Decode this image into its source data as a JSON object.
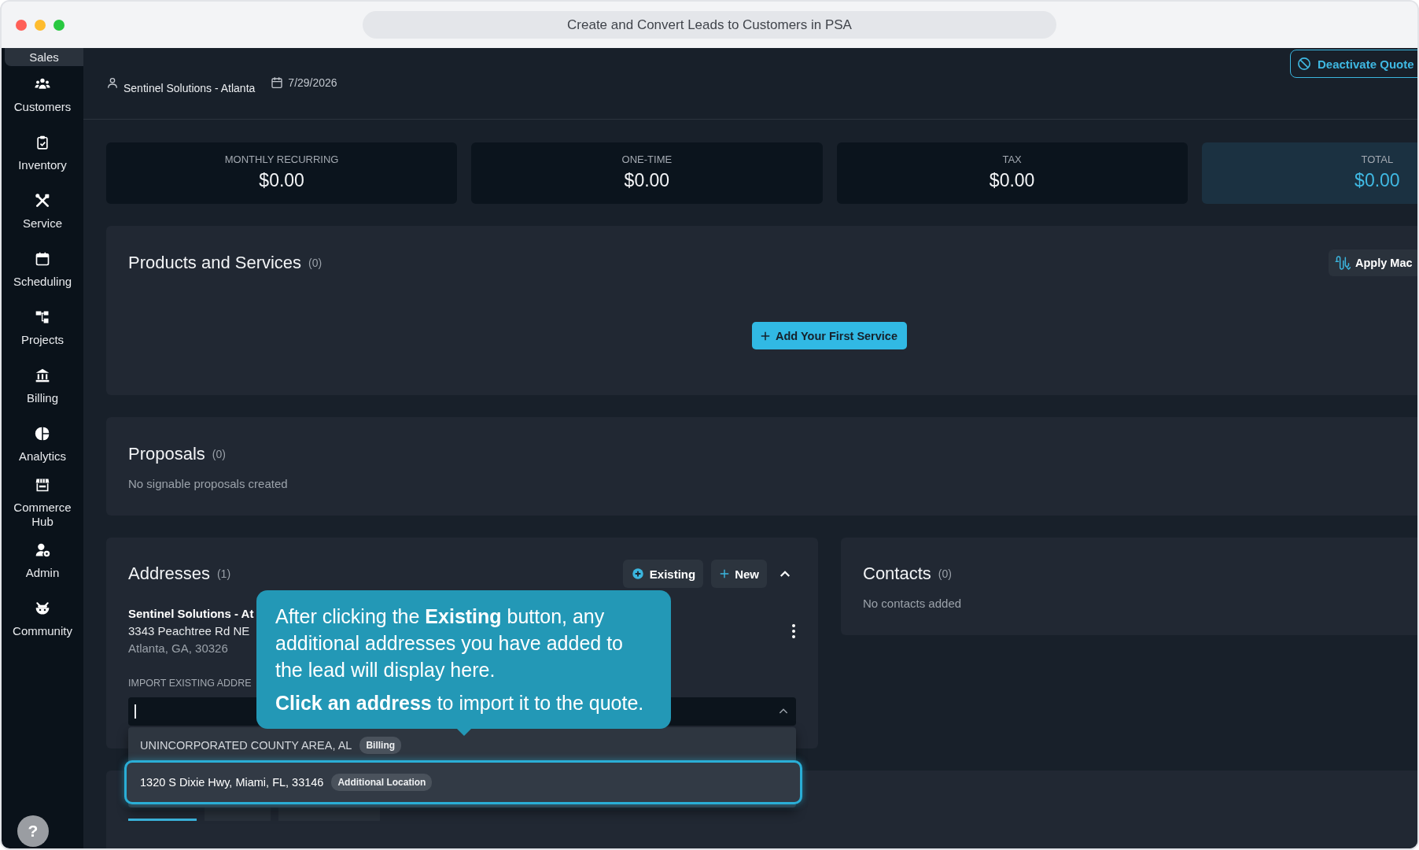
{
  "window": {
    "title": "Create and Convert Leads to Customers in PSA"
  },
  "sidebar": {
    "items": [
      {
        "label": "Sales",
        "selected": true
      },
      {
        "label": "Customers",
        "selected": false
      },
      {
        "label": "Inventory",
        "selected": false
      },
      {
        "label": "Service",
        "selected": false
      },
      {
        "label": "Scheduling",
        "selected": false
      },
      {
        "label": "Projects",
        "selected": false
      },
      {
        "label": "Billing",
        "selected": false
      },
      {
        "label": "Analytics",
        "selected": false
      },
      {
        "label": "Commerce Hub",
        "selected": false
      },
      {
        "label": "Admin",
        "selected": false
      },
      {
        "label": "Community",
        "selected": false
      }
    ],
    "help": "?"
  },
  "header": {
    "customer": "Sentinel Solutions - Atlanta",
    "date": "7/29/2026",
    "deactivate_button": "Deactivate Quote"
  },
  "summary": [
    {
      "label": "MONTHLY RECURRING",
      "value": "$0.00",
      "highlighted": false
    },
    {
      "label": "ONE-TIME",
      "value": "$0.00",
      "highlighted": false
    },
    {
      "label": "TAX",
      "value": "$0.00",
      "highlighted": false
    },
    {
      "label": "TOTAL",
      "value": "$0.00",
      "highlighted": true
    }
  ],
  "products": {
    "title": "Products and Services",
    "count": "(0)",
    "macro_button": "Apply Mac",
    "add_button": "Add Your First Service"
  },
  "proposals": {
    "title": "Proposals",
    "count": "(0)",
    "empty_text": "No signable proposals created"
  },
  "addresses": {
    "title": "Addresses",
    "count": "(1)",
    "existing_button": "Existing",
    "new_button": "New",
    "expanded": true,
    "address": {
      "name": "Sentinel Solutions - At",
      "street": "3343 Peachtree Rd NE",
      "city": "Atlanta, GA, 30326"
    },
    "import_label": "IMPORT EXISTING ADDRE",
    "import_field": {
      "open": true
    },
    "options": [
      {
        "text": "UNINCORPORATED COUNTY AREA, AL",
        "tag": "Billing",
        "highlighted": false
      },
      {
        "text": "1320 S Dixie Hwy, Miami, FL, 33146",
        "tag": "Additional Location",
        "highlighted": true
      }
    ]
  },
  "contacts": {
    "title": "Contacts",
    "count": "(0)",
    "empty_text": "No contacts added"
  },
  "detail_tabs": [
    {
      "selected": true
    },
    {
      "selected": false
    },
    {
      "selected": false
    }
  ],
  "tutorial_tip": {
    "paragraphs": [
      "After clicking the **Existing** button, any additional addresses you have added to the lead will display here.",
      "**Click an address** to import it to the quote."
    ]
  }
}
